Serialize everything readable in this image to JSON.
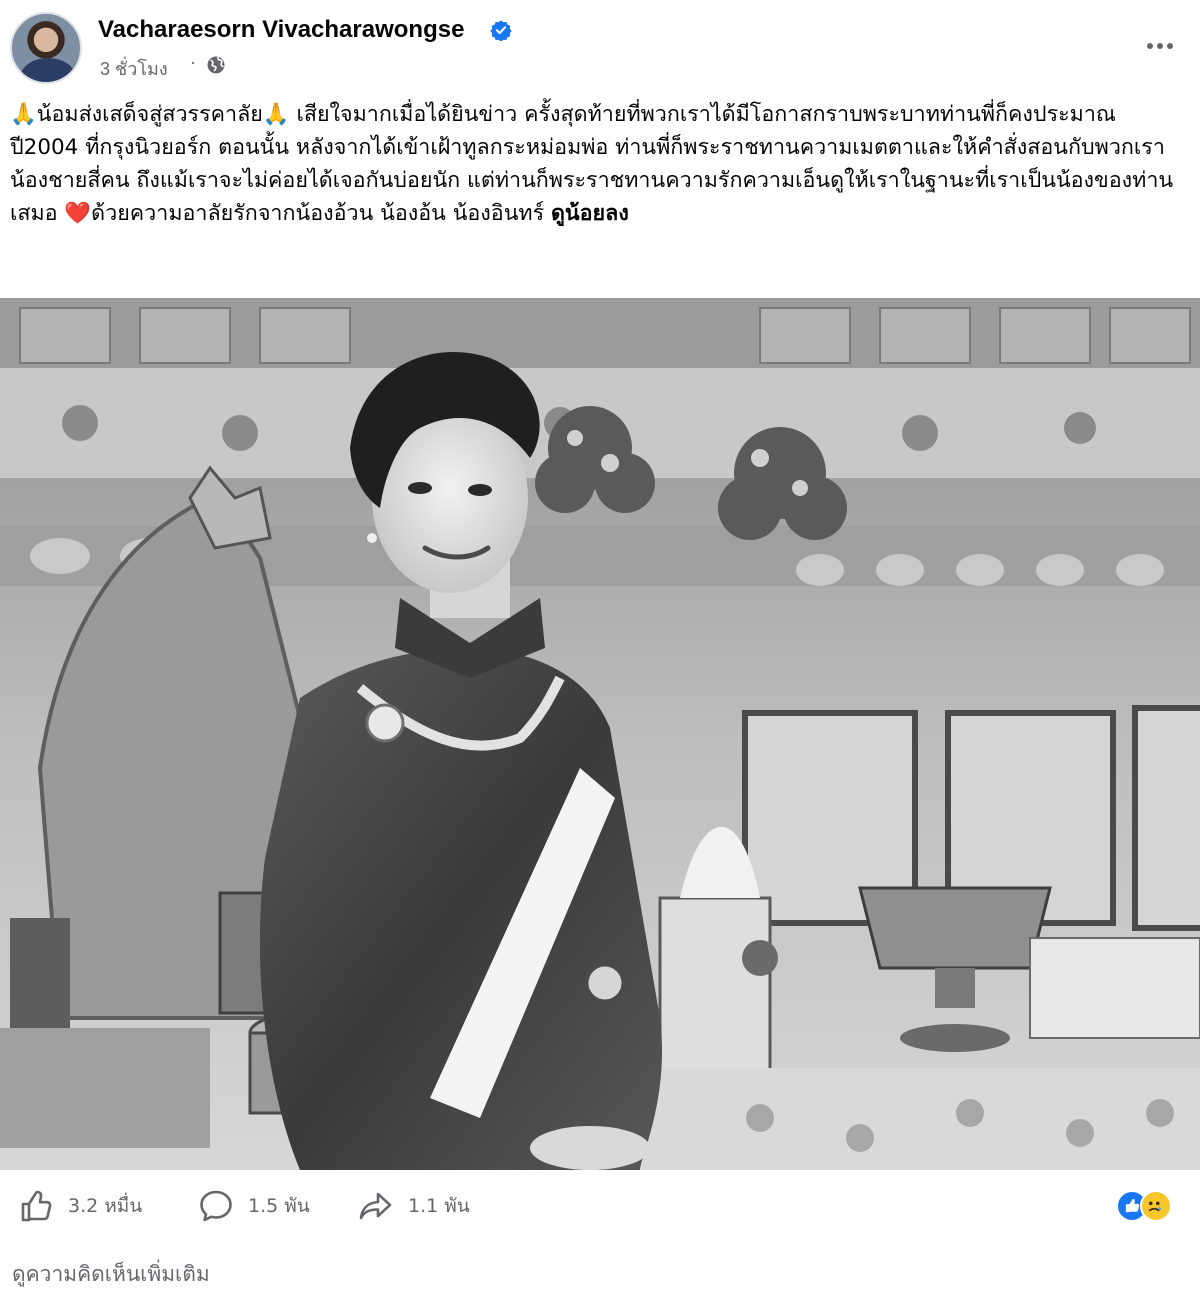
{
  "post": {
    "author": "Vacharaesorn Vivacharawongse",
    "verified": true,
    "time": "3 ชั่วโมง",
    "separator": "·",
    "privacy_icon": "globe-icon",
    "more_icon": "more-options-icon",
    "text": {
      "pray_emoji": "🙏",
      "part1": "น้อมส่งเสด็จสู่สวรรคาลัย",
      "part2": " เสียใจมากเมื่อได้ยินข่าว ครั้งสุดท้ายที่พวกเราได้มีโอกาสกราบพระบาทท่านพี่ก็คงประมาณปี2004 ที่กรุงนิวยอร์ก ตอนนั้น หลังจากได้เข้าเฝ้าทูลกระหม่อมพ่อ ท่านพี่ก็พระราชทานความเมตตาและให้คำสั่งสอนกับพวกเราน้องชายสี่คน ถึงแม้เราจะไม่ค่อยได้เจอกันบ่อยนัก แต่ท่านก็พระราชทานความรักความเอ็นดูให้เราในฐานะที่เราเป็นน้องของท่านเสมอ ",
      "heart_emoji": "❤️",
      "part3": "ด้วยความอาลัยรักจากน้องอ้วน น้องอ้น น้องอินทร์ ",
      "part4": "ดูน้อยลง"
    }
  },
  "colors": {
    "facebook_blue": "#1877f2",
    "secondary_text": "#65676b",
    "heart_red": "#e41e3f"
  },
  "actions": {
    "like": {
      "icon": "thumbs-up-icon",
      "count": "3.2 หมื่น"
    },
    "comment": {
      "icon": "comment-bubble-icon",
      "count": "1.5 พัน"
    },
    "share": {
      "icon": "share-arrow-icon",
      "count": "1.1 พัน"
    },
    "reactions": [
      "like-reaction-icon",
      "sad-reaction-icon"
    ]
  },
  "footer": {
    "more_comments": "ดูความคิดเห็นเพิ่มเติม"
  }
}
